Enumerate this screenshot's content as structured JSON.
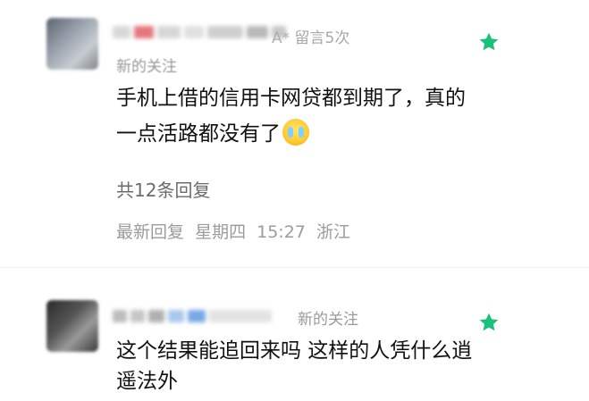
{
  "comments": [
    {
      "meta": "留言5次",
      "follow_label": "新的关注",
      "text_line1": "手机上借的信用卡网贷都到期了，真的",
      "text_line2": "一点活路都没有了",
      "emoji": "crying-face",
      "replies_label": "共12条回复",
      "latest_label": "最新回复",
      "latest_day": "星期四",
      "latest_time": "15:27",
      "latest_location": "浙江",
      "star_color": "#19c27a"
    },
    {
      "follow_label": "新的关注",
      "text_line1": "这个结果能追回来吗 这样的人凭什么逍",
      "text_line2": "遥法外",
      "star_color": "#19c27a"
    }
  ]
}
